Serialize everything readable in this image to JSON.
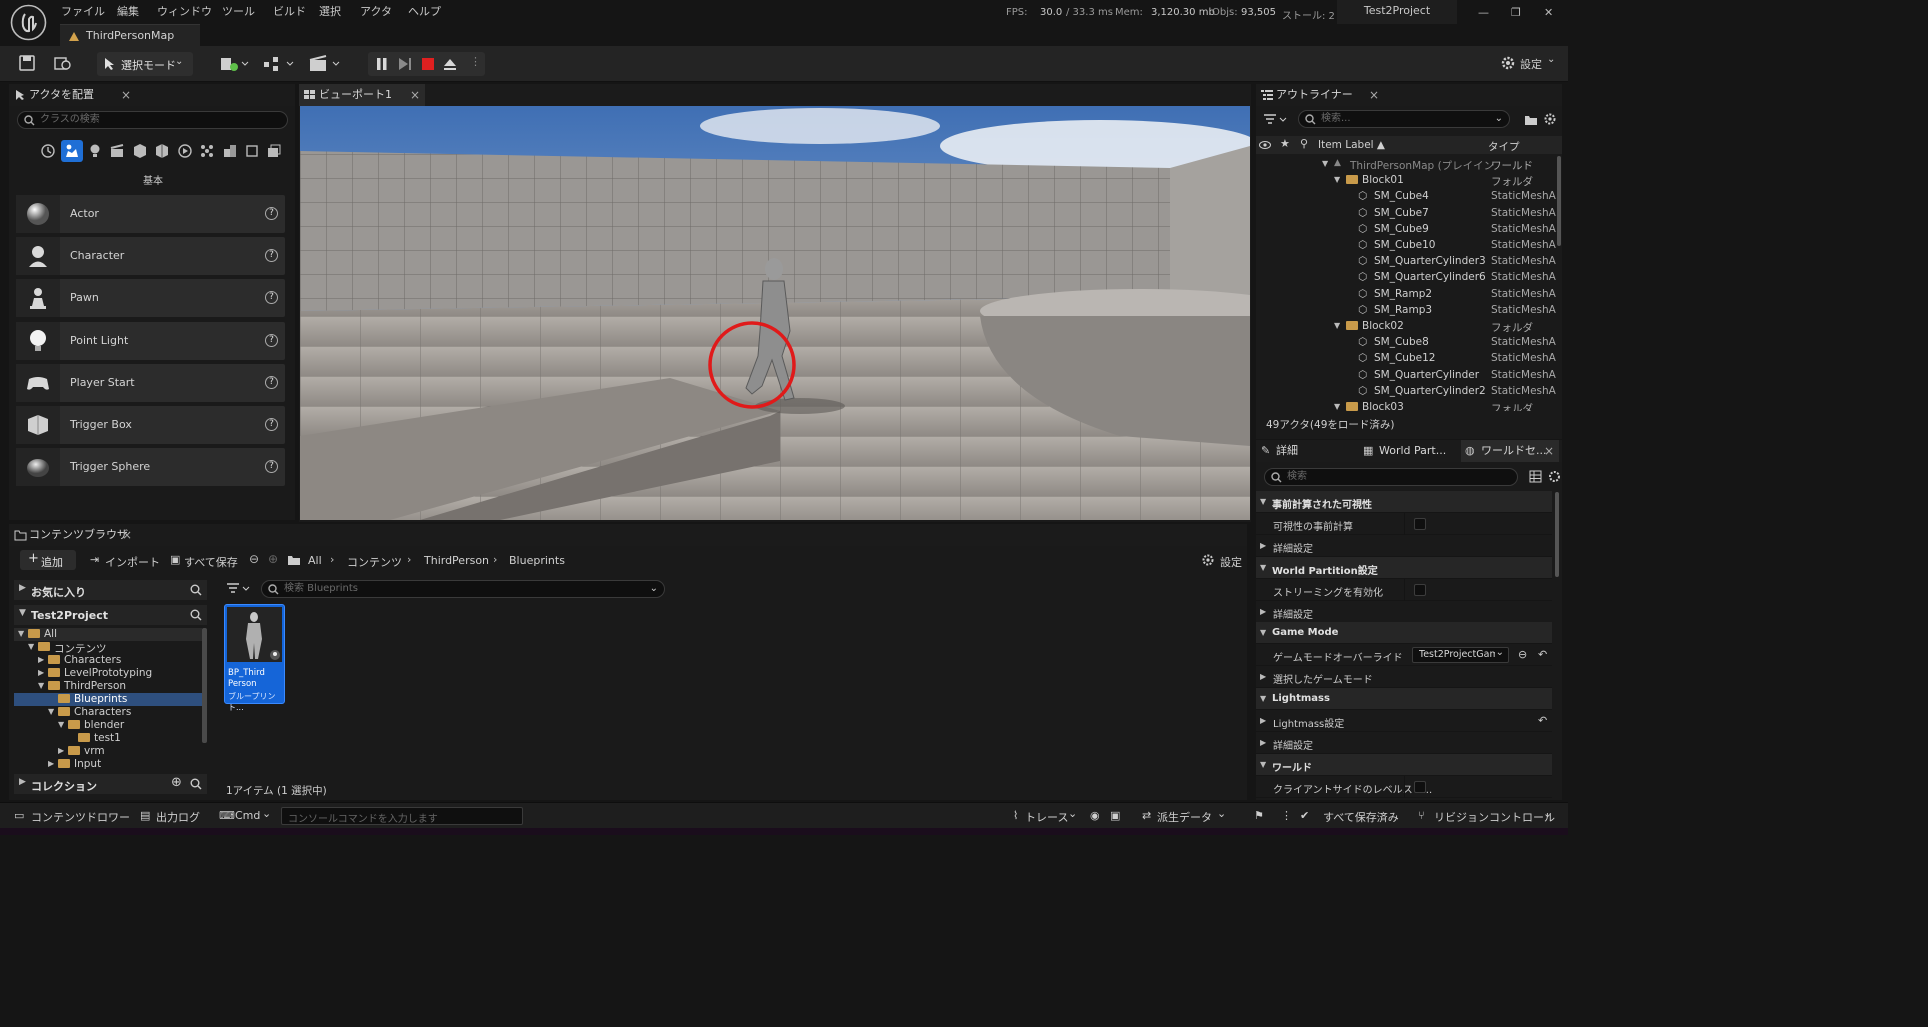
{
  "menu": {
    "items": [
      "ファイル",
      "編集",
      "ウィンドウ",
      "ツール",
      "ビルド",
      "選択",
      "アクタ",
      "ヘルプ"
    ],
    "stats": {
      "fps_label": "FPS:",
      "fps": "30.0",
      "ms": "/ 33.3 ms",
      "mem_label": "Mem:",
      "mem": "3,120.30 mb",
      "objs_label": "Objs:",
      "objs": "93,505",
      "stall": "ストール: 2"
    },
    "project": "Test2Project"
  },
  "map_tab": "ThirdPersonMap",
  "toolbar": {
    "select_mode": "選択モード",
    "settings": "設定"
  },
  "place_actors": {
    "tab": "アクタを配置",
    "search_placeholder": "クラスの検索",
    "category": "基本",
    "items": [
      "Actor",
      "Character",
      "Pawn",
      "Point Light",
      "Player Start",
      "Trigger Box",
      "Trigger Sphere"
    ]
  },
  "viewport": {
    "tab": "ビューポート1"
  },
  "outliner": {
    "tab": "アウトライナー",
    "search_placeholder": "検索...",
    "col_label": "Item Label ▲",
    "col_type": "タイプ",
    "rows": [
      {
        "label": "ThirdPersonMap (プレイイン",
        "type": "ワールド",
        "indent": 0,
        "kind": "map"
      },
      {
        "label": "Block01",
        "type": "フォルダ",
        "indent": 1,
        "kind": "folder"
      },
      {
        "label": "SM_Cube4",
        "type": "StaticMeshActor",
        "indent": 2,
        "kind": "mesh"
      },
      {
        "label": "SM_Cube7",
        "type": "StaticMeshActor",
        "indent": 2,
        "kind": "mesh"
      },
      {
        "label": "SM_Cube9",
        "type": "StaticMeshActor",
        "indent": 2,
        "kind": "mesh"
      },
      {
        "label": "SM_Cube10",
        "type": "StaticMeshActor",
        "indent": 2,
        "kind": "mesh"
      },
      {
        "label": "SM_QuarterCylinder3",
        "type": "StaticMeshActor",
        "indent": 2,
        "kind": "mesh"
      },
      {
        "label": "SM_QuarterCylinder6",
        "type": "StaticMeshActor",
        "indent": 2,
        "kind": "mesh"
      },
      {
        "label": "SM_Ramp2",
        "type": "StaticMeshActor",
        "indent": 2,
        "kind": "mesh"
      },
      {
        "label": "SM_Ramp3",
        "type": "StaticMeshActor",
        "indent": 2,
        "kind": "mesh"
      },
      {
        "label": "Block02",
        "type": "フォルダ",
        "indent": 1,
        "kind": "folder"
      },
      {
        "label": "SM_Cube8",
        "type": "StaticMeshActor",
        "indent": 2,
        "kind": "mesh"
      },
      {
        "label": "SM_Cube12",
        "type": "StaticMeshActor",
        "indent": 2,
        "kind": "mesh"
      },
      {
        "label": "SM_QuarterCylinder",
        "type": "StaticMeshActor",
        "indent": 2,
        "kind": "mesh"
      },
      {
        "label": "SM_QuarterCylinder2",
        "type": "StaticMeshActor",
        "indent": 2,
        "kind": "mesh"
      },
      {
        "label": "Block03",
        "type": "フォルダ",
        "indent": 1,
        "kind": "folder"
      }
    ],
    "footer": "49アクタ(49をロード済み)"
  },
  "details": {
    "tabs": [
      "詳細",
      "World Part...",
      "ワールドセ..."
    ],
    "search_placeholder": "検索",
    "rows": [
      {
        "text": "事前計算された可視性",
        "kind": "section"
      },
      {
        "text": "可視性の事前計算",
        "kind": "check"
      },
      {
        "text": "詳細設定",
        "kind": "sub"
      },
      {
        "text": "World Partition設定",
        "kind": "section"
      },
      {
        "text": "ストリーミングを有効化",
        "kind": "check"
      },
      {
        "text": "詳細設定",
        "kind": "sub"
      },
      {
        "text": "Game Mode",
        "kind": "section"
      },
      {
        "text": "ゲームモードオーバーライド",
        "kind": "dropdown",
        "value": "Test2ProjectGam"
      },
      {
        "text": "選択したゲームモード",
        "kind": "sub"
      },
      {
        "text": "Lightmass",
        "kind": "section"
      },
      {
        "text": "Lightmass設定",
        "kind": "subreset"
      },
      {
        "text": "詳細設定",
        "kind": "sub"
      },
      {
        "text": "ワールド",
        "kind": "section"
      },
      {
        "text": "クライアントサイドのレベルスト...",
        "kind": "check"
      }
    ]
  },
  "content_browser": {
    "tab": "コンテンツブラウザ",
    "add": "追加",
    "import": "インポート",
    "save_all": "すべて保存",
    "path": [
      "All",
      "コンテンツ",
      "ThirdPerson",
      "Blueprints"
    ],
    "settings": "設定",
    "favorites": "お気に入り",
    "project": "Test2Project",
    "tree": [
      {
        "label": "All",
        "indent": 0,
        "open": true
      },
      {
        "label": "コンテンツ",
        "indent": 1,
        "open": true
      },
      {
        "label": "Characters",
        "indent": 2,
        "open": false
      },
      {
        "label": "LevelPrototyping",
        "indent": 2,
        "open": false
      },
      {
        "label": "ThirdPerson",
        "indent": 2,
        "open": true
      },
      {
        "label": "Blueprints",
        "indent": 3,
        "open": null,
        "selected": true
      },
      {
        "label": "Characters",
        "indent": 3,
        "open": true
      },
      {
        "label": "blender",
        "indent": 4,
        "open": true
      },
      {
        "label": "test1",
        "indent": 5,
        "open": null
      },
      {
        "label": "vrm",
        "indent": 4,
        "open": false
      },
      {
        "label": "Input",
        "indent": 3,
        "open": false
      }
    ],
    "collections": "コレクション",
    "search_placeholder": "検索 Blueprints",
    "asset": {
      "name_line1": "BP_Third",
      "name_line2": "Person",
      "type": "ブループリント..."
    },
    "status": "1アイテム (1 選択中)"
  },
  "bottom": {
    "drawer": "コンテンツドロワー",
    "output": "出力ログ",
    "cmd": "Cmd",
    "console_placeholder": "コンソールコマンドを入力します",
    "trace": "トレース",
    "derived": "派生データ",
    "save_all": "すべて保存済み",
    "revision": "リビジョンコントロール"
  }
}
